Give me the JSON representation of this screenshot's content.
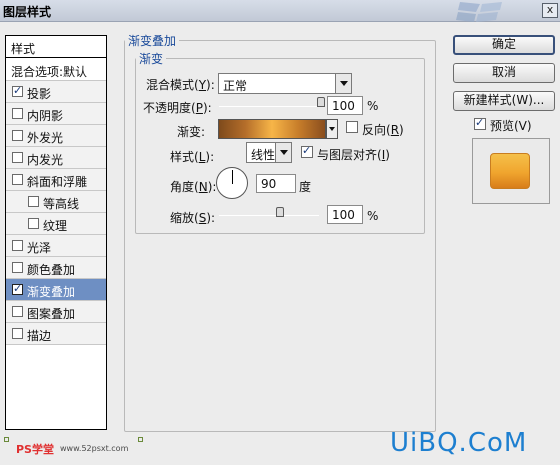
{
  "window": {
    "title": "图层样式",
    "close": "x"
  },
  "styles_list": {
    "header": "样式",
    "blend_defaults": "混合选项:默认",
    "items": [
      {
        "label": "投影",
        "checked": true,
        "selected": false
      },
      {
        "label": "内阴影",
        "checked": false,
        "selected": false
      },
      {
        "label": "外发光",
        "checked": false,
        "selected": false
      },
      {
        "label": "内发光",
        "checked": false,
        "selected": false
      },
      {
        "label": "斜面和浮雕",
        "checked": false,
        "selected": false
      },
      {
        "label": "等高线",
        "checked": false,
        "selected": false
      },
      {
        "label": "纹理",
        "checked": false,
        "selected": false
      },
      {
        "label": "光泽",
        "checked": false,
        "selected": false
      },
      {
        "label": "颜色叠加",
        "checked": false,
        "selected": false
      },
      {
        "label": "渐变叠加",
        "checked": true,
        "selected": true
      },
      {
        "label": "图案叠加",
        "checked": false,
        "selected": false
      },
      {
        "label": "描边",
        "checked": false,
        "selected": false
      }
    ]
  },
  "gradient_overlay": {
    "group_title": "渐变叠加",
    "sub_title": "渐变",
    "blend_mode_label": "混合模式",
    "blend_mode_key": "Y",
    "blend_mode_value": "正常",
    "opacity_label": "不透明度",
    "opacity_key": "P",
    "opacity_value": "100",
    "opacity_level": 1.0,
    "percent": "%",
    "gradient_label": "渐变:",
    "reverse_label": "反向",
    "reverse_key": "R",
    "reverse_checked": false,
    "style_label": "样式",
    "style_key": "L",
    "style_value": "线性",
    "align_label": "与图层对齐",
    "align_key": "I",
    "align_checked": true,
    "angle_label": "角度",
    "angle_key": "N",
    "angle_value": "90",
    "angle_unit": "度",
    "scale_label": "缩放",
    "scale_key": "S",
    "scale_value": "100",
    "scale_level": 0.5,
    "gradient_colors": [
      "#7e4a1c",
      "#b56e2a",
      "#f7b548",
      "#c77d2a",
      "#8a4e1e"
    ]
  },
  "buttons": {
    "ok": "确定",
    "cancel": "取消",
    "new_style": "新建样式(W)...",
    "preview_label": "预览(V)",
    "preview_checked": true
  },
  "watermarks": {
    "left": "PS学堂",
    "left_small": "www.52psxt.com",
    "right": "UiBQ.CoM"
  }
}
